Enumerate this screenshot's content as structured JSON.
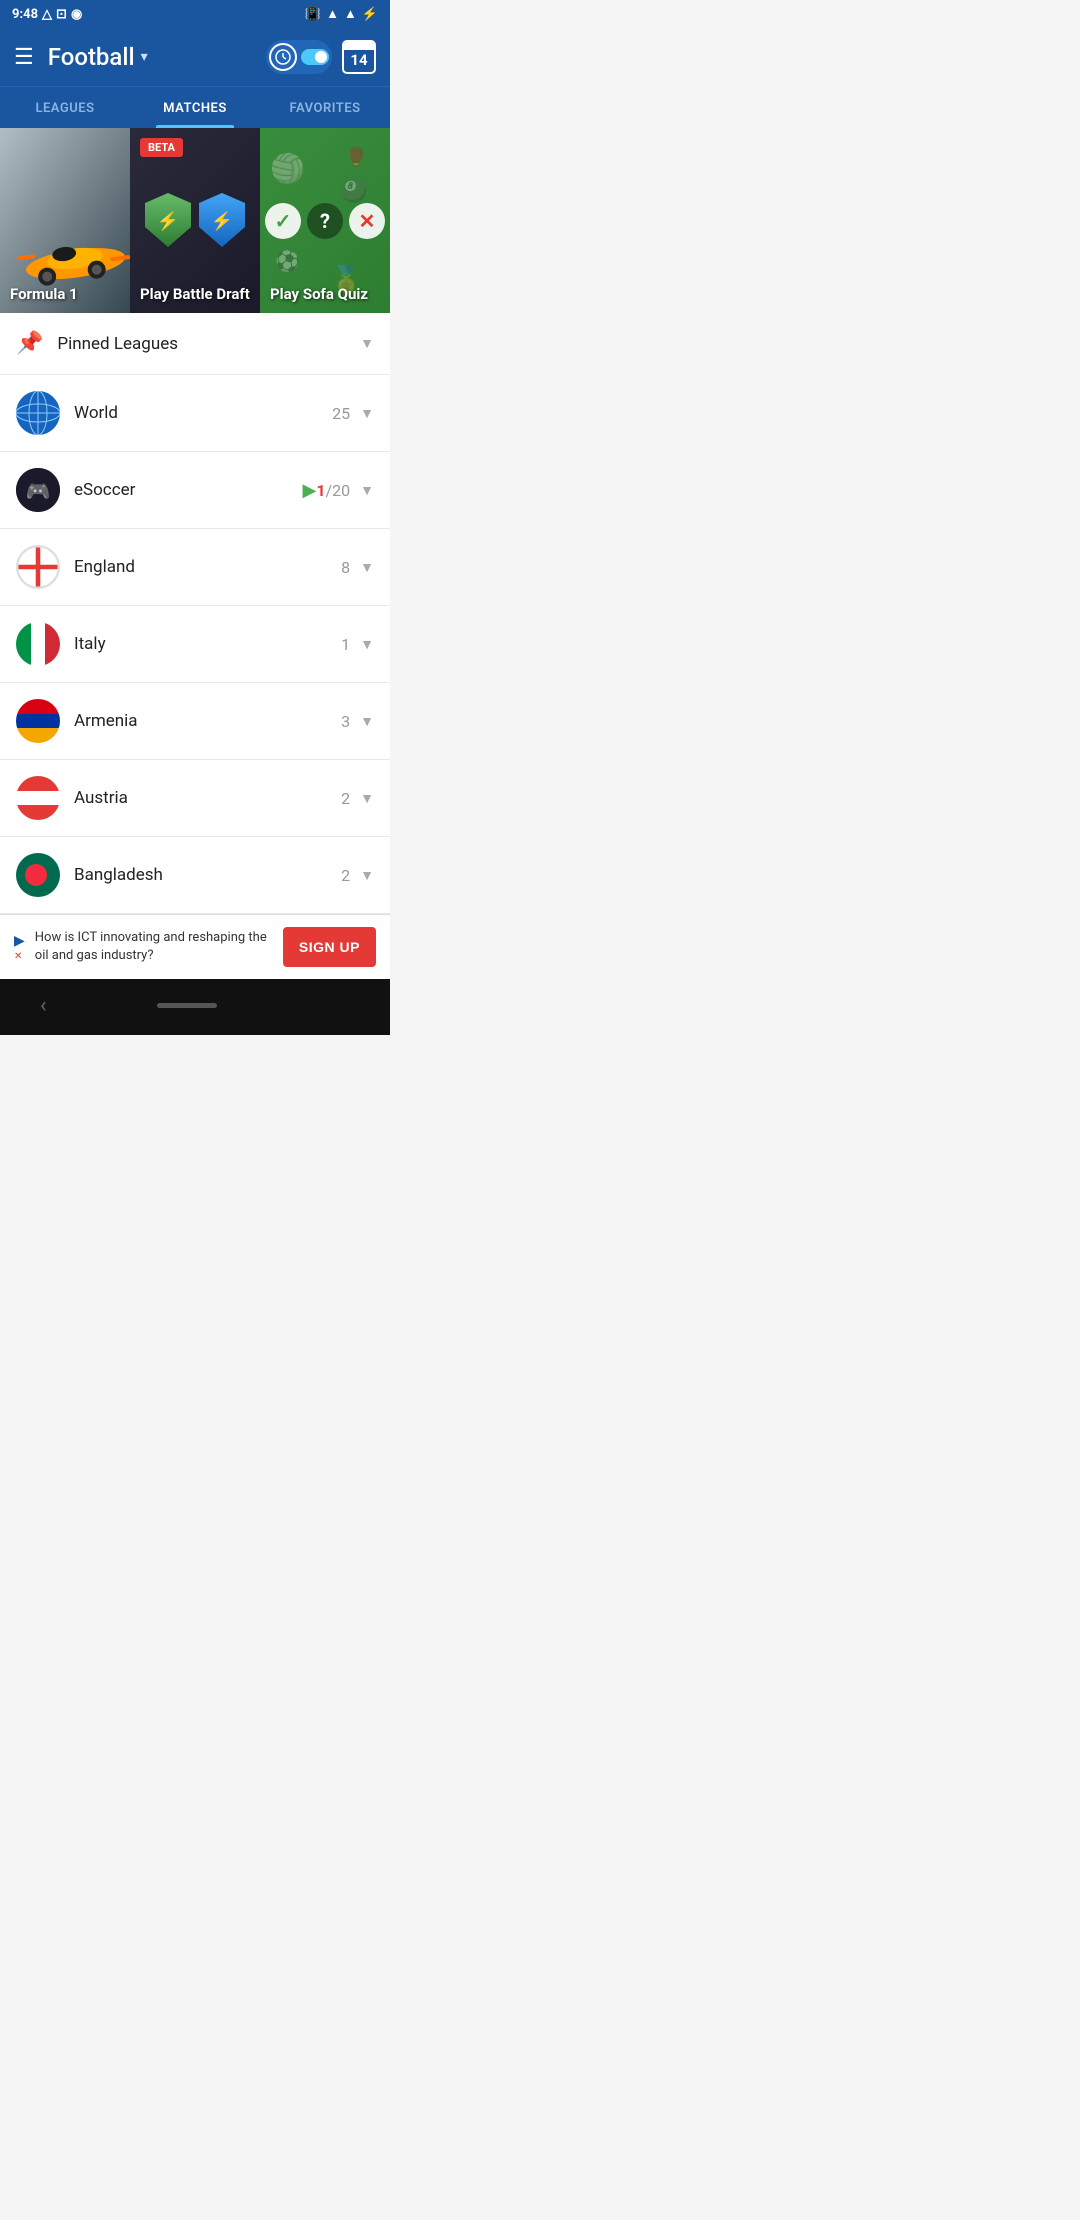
{
  "statusBar": {
    "time": "9:48",
    "batteryIcon": "🔋"
  },
  "header": {
    "menuLabel": "☰",
    "title": "Football",
    "dropdownArrow": "▾",
    "calendarNumber": "14"
  },
  "tabs": [
    {
      "id": "leagues",
      "label": "LEAGUES",
      "active": false
    },
    {
      "id": "matches",
      "label": "MATCHES",
      "active": true
    },
    {
      "id": "favorites",
      "label": "FAVORITES",
      "active": false
    }
  ],
  "cards": [
    {
      "id": "formula1",
      "label": "Formula 1"
    },
    {
      "id": "battle",
      "label": "Play Battle Draft",
      "badge": "BETA"
    },
    {
      "id": "quiz",
      "label": "Play Sofa Quiz"
    }
  ],
  "pinnedLeagues": {
    "label": "Pinned Leagues"
  },
  "listItems": [
    {
      "id": "world",
      "name": "World",
      "count": "25",
      "fraction": false
    },
    {
      "id": "esoccer",
      "name": "eSoccer",
      "count": "1/20",
      "fraction": true,
      "live": true
    },
    {
      "id": "england",
      "name": "England",
      "count": "8",
      "fraction": false
    },
    {
      "id": "italy",
      "name": "Italy",
      "count": "1",
      "fraction": false
    },
    {
      "id": "armenia",
      "name": "Armenia",
      "count": "3",
      "fraction": false
    },
    {
      "id": "austria",
      "name": "Austria",
      "count": "2",
      "fraction": false
    },
    {
      "id": "bangladesh",
      "name": "Bangladesh",
      "count": "2",
      "fraction": false
    }
  ],
  "adBanner": {
    "text": "How is ICT innovating and reshaping the oil and gas industry?",
    "buttonLabel": "SIGN UP"
  }
}
